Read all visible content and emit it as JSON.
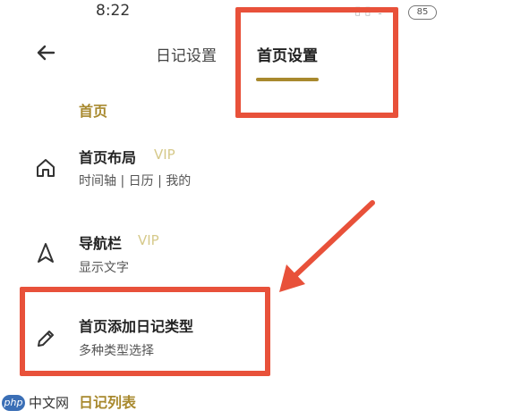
{
  "status_bar": {
    "time": "8:22",
    "signal_icons": "▯ ▯ ᯤ",
    "battery": "85"
  },
  "nav": {
    "back_icon": "arrow-left-icon",
    "tabs": [
      {
        "label": "日记设置",
        "active": false
      },
      {
        "label": "首页设置",
        "active": true
      }
    ]
  },
  "sections": {
    "home": {
      "header": "首页"
    },
    "diary_list": {
      "header": "日记列表"
    }
  },
  "rows": [
    {
      "icon": "home-icon",
      "title": "首页布局",
      "badge": "VIP",
      "subtitle": "时间轴 | 日历 | 我的"
    },
    {
      "icon": "navigation-icon",
      "title": "导航栏",
      "badge": "VIP",
      "subtitle": "显示文字"
    },
    {
      "icon": "pencil-icon",
      "title": "首页添加日记类型",
      "subtitle": "多种类型选择"
    }
  ],
  "colors": {
    "accent": "#a8892e",
    "annotation": "#e8513a",
    "vip": "#d6c98a"
  },
  "watermark": {
    "logo": "php",
    "text": "中文网"
  }
}
